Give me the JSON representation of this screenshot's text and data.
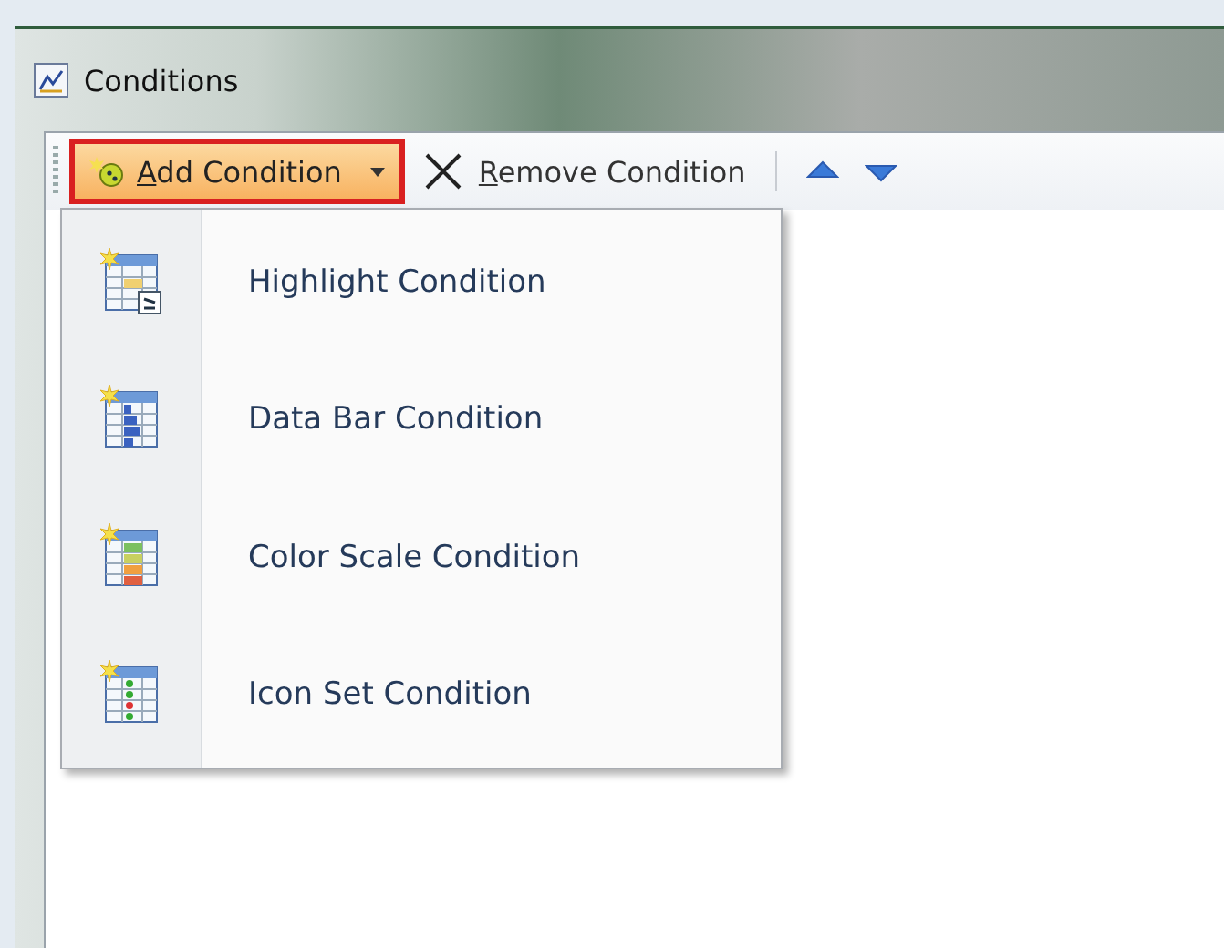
{
  "window": {
    "title": "Conditions"
  },
  "toolbar": {
    "add_button": {
      "label": "Add Condition",
      "open": true
    },
    "remove_button": {
      "label": "Remove Condition"
    }
  },
  "menu": {
    "items": [
      {
        "label": "Highlight Condition",
        "kind": "highlight"
      },
      {
        "label": "Data Bar Condition",
        "kind": "databar"
      },
      {
        "label": "Color Scale Condition",
        "kind": "colorscale"
      },
      {
        "label": "Icon Set Condition",
        "kind": "iconset"
      }
    ]
  }
}
